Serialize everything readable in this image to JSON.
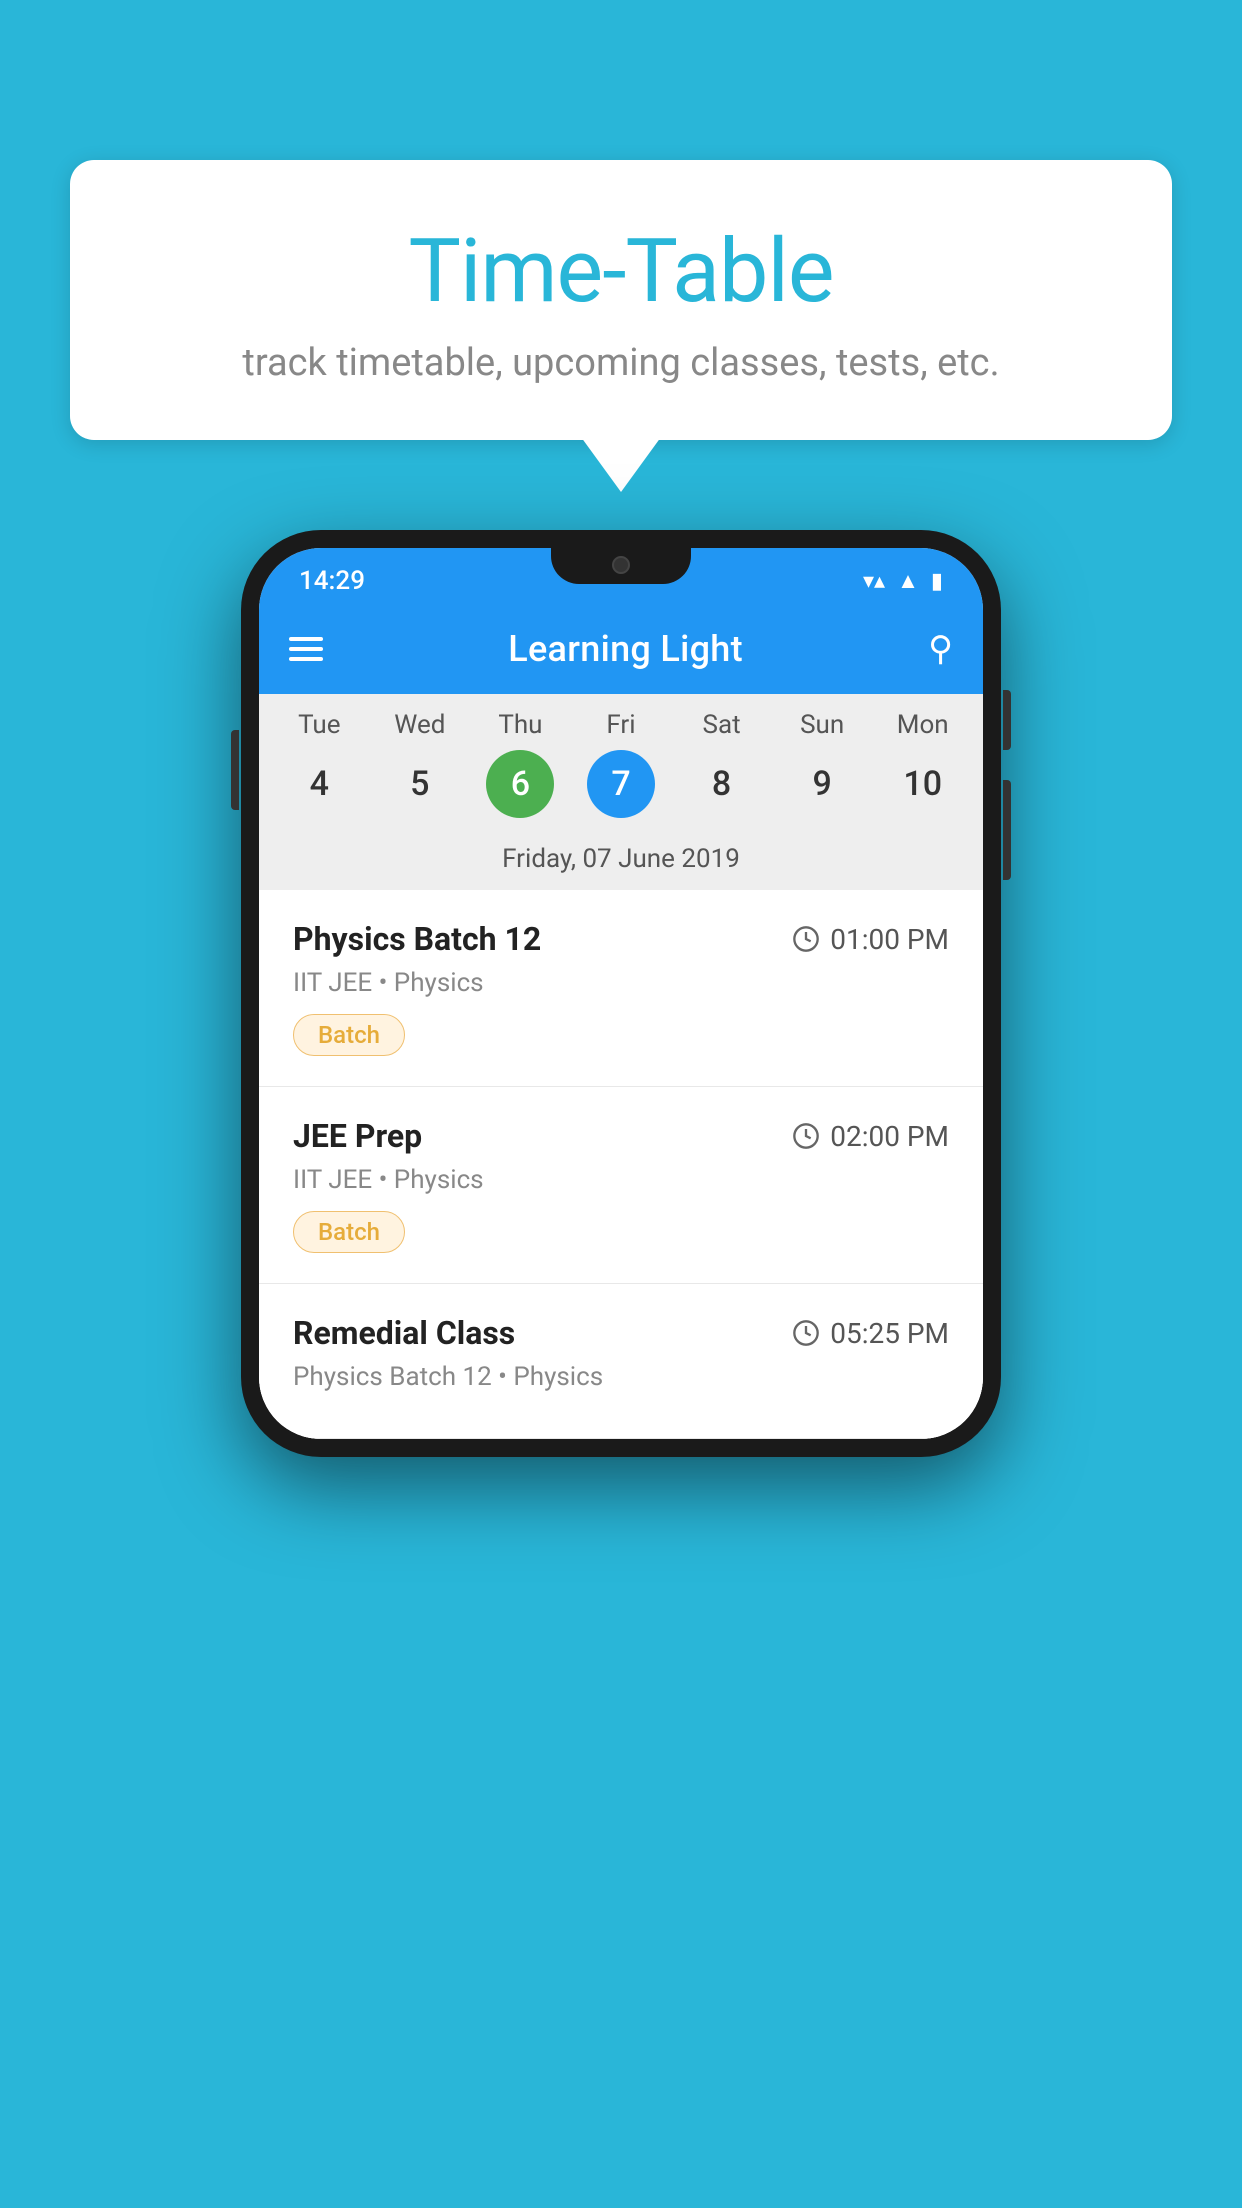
{
  "background_color": "#29B6D8",
  "bubble": {
    "title": "Time-Table",
    "subtitle": "track timetable, upcoming classes, tests, etc."
  },
  "phone": {
    "status_bar": {
      "time": "14:29"
    },
    "app_bar": {
      "title": "Learning Light"
    },
    "calendar": {
      "days": [
        "Tue",
        "Wed",
        "Thu",
        "Fri",
        "Sat",
        "Sun",
        "Mon"
      ],
      "dates": [
        {
          "number": "4",
          "state": "normal"
        },
        {
          "number": "5",
          "state": "normal"
        },
        {
          "number": "6",
          "state": "today"
        },
        {
          "number": "7",
          "state": "selected"
        },
        {
          "number": "8",
          "state": "normal"
        },
        {
          "number": "9",
          "state": "normal"
        },
        {
          "number": "10",
          "state": "normal"
        }
      ],
      "selected_date_label": "Friday, 07 June 2019"
    },
    "schedule": [
      {
        "title": "Physics Batch 12",
        "time": "01:00 PM",
        "subject": "IIT JEE • Physics",
        "tag": "Batch"
      },
      {
        "title": "JEE Prep",
        "time": "02:00 PM",
        "subject": "IIT JEE • Physics",
        "tag": "Batch"
      },
      {
        "title": "Remedial Class",
        "time": "05:25 PM",
        "subject": "Physics Batch 12 • Physics",
        "tag": ""
      }
    ]
  }
}
